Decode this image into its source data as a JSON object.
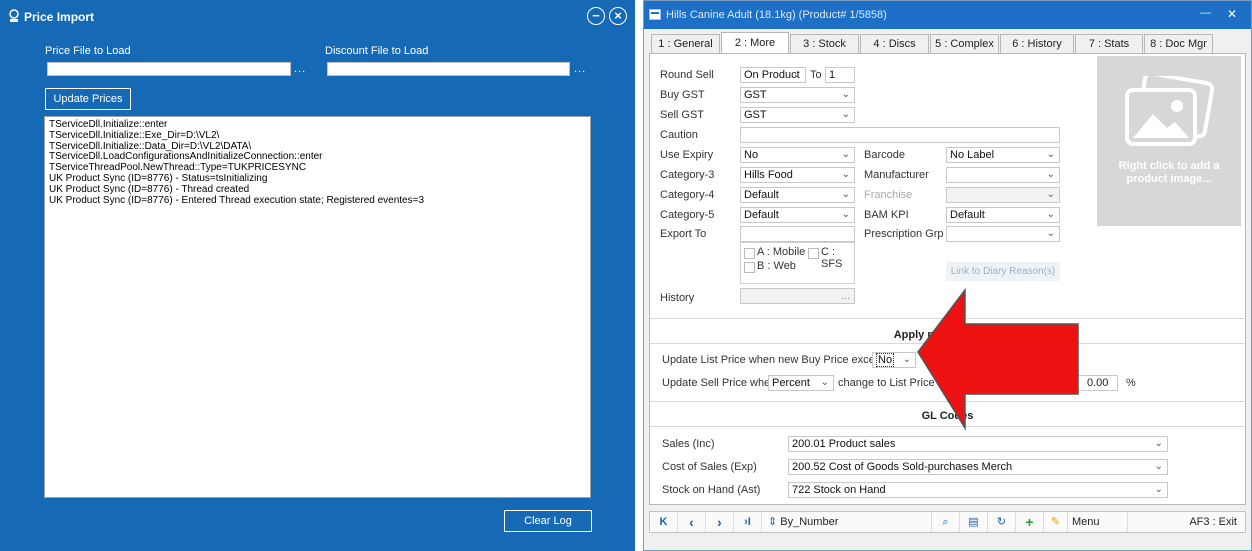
{
  "left_window": {
    "title": "Price Import",
    "price_file_label": "Price File to Load",
    "discount_file_label": "Discount File to Load",
    "price_file_value": "",
    "discount_file_value": "",
    "browse_label": "...",
    "update_button": "Update Prices",
    "clear_button": "Clear Log",
    "minimize_glyph": "−",
    "close_glyph": "×",
    "log_lines": [
      "TServiceDll.Initialize::enter",
      "TServiceDll.Initialize::Exe_Dir=D:\\VL2\\",
      "TServiceDll.Initialize::Data_Dir=D:\\VL2\\DATA\\",
      "TServiceDll.LoadConfigurationsAndInitializeConnection::enter",
      "TServiceThreadPool.NewThread::Type=TUKPRICESYNC",
      "UK Product Sync (ID=8776) - Status=tsInitializing",
      "UK Product Sync (ID=8776) - Thread created",
      "UK Product Sync (ID=8776) - Entered Thread execution state; Registered eventes=3"
    ]
  },
  "right_window": {
    "title": "Hills Canine Adult (18.1kg) (Product# 1/5858)",
    "minimize_glyph": "—",
    "close_glyph": "✕",
    "tabs": [
      {
        "label": "1 : General"
      },
      {
        "label": "2 : More"
      },
      {
        "label": "3 : Stock"
      },
      {
        "label": "4 : Discs"
      },
      {
        "label": "5 : Complex"
      },
      {
        "label": "6 : History"
      },
      {
        "label": "7 : Stats"
      },
      {
        "label": "8 : Doc Mgr"
      }
    ],
    "fields": {
      "round_sell_label": "Round Sell",
      "round_sell_value": "On Product",
      "to_label": "To",
      "to_value": "1",
      "buy_gst_label": "Buy GST",
      "buy_gst_value": "GST",
      "sell_gst_label": "Sell GST",
      "sell_gst_value": "GST",
      "caution_label": "Caution",
      "use_expiry_label": "Use Expiry",
      "use_expiry_value": "No",
      "category3_label": "Category-3",
      "category3_value": "Hills Food",
      "category4_label": "Category-4",
      "category4_value": "Default",
      "category5_label": "Category-5",
      "category5_value": "Default",
      "export_to_label": "Export To",
      "barcode_label": "Barcode",
      "barcode_value": "No Label",
      "manufacturer_label": "Manufacturer",
      "franchise_label": "Franchise",
      "bam_kpi_label": "BAM KPI",
      "bam_kpi_value": "Default",
      "prescription_label": "Prescription Grp",
      "export_a": "A : Mobile",
      "export_c": "C : SFS",
      "export_b": "B : Web",
      "diary_link": "Link to Diary Reason(s)",
      "history_label": "History",
      "history_btn": "..."
    },
    "image_hint": "Right click to add a product image...",
    "price_section": {
      "title": "Apply price changes",
      "update_list_label": "Update List Price when new Buy Price exceeds",
      "update_list_value": "No",
      "update_sell_label": "Update Sell Price when",
      "update_sell_value": "Percent",
      "change_label": "change to List Price is",
      "threshold_value": "0.00",
      "percent_sign": "%"
    },
    "gl_section": {
      "title": "GL Codes",
      "rows": [
        {
          "label": "Sales  (Inc)",
          "value": "200.01 Product sales"
        },
        {
          "label": "Cost of Sales  (Exp)",
          "value": "200.52 Cost of Goods Sold-purchases Merch"
        },
        {
          "label": "Stock on Hand  (Ast)",
          "value": "722 Stock on Hand"
        }
      ]
    },
    "navbar": {
      "first": "K",
      "prev": "‹",
      "next": "›",
      "last": "›I",
      "sort_label": "By_Number",
      "menu_label": "Menu",
      "exit_label": "AF3 : Exit"
    }
  },
  "overlay": {
    "arrow_color": "#ee1111"
  }
}
